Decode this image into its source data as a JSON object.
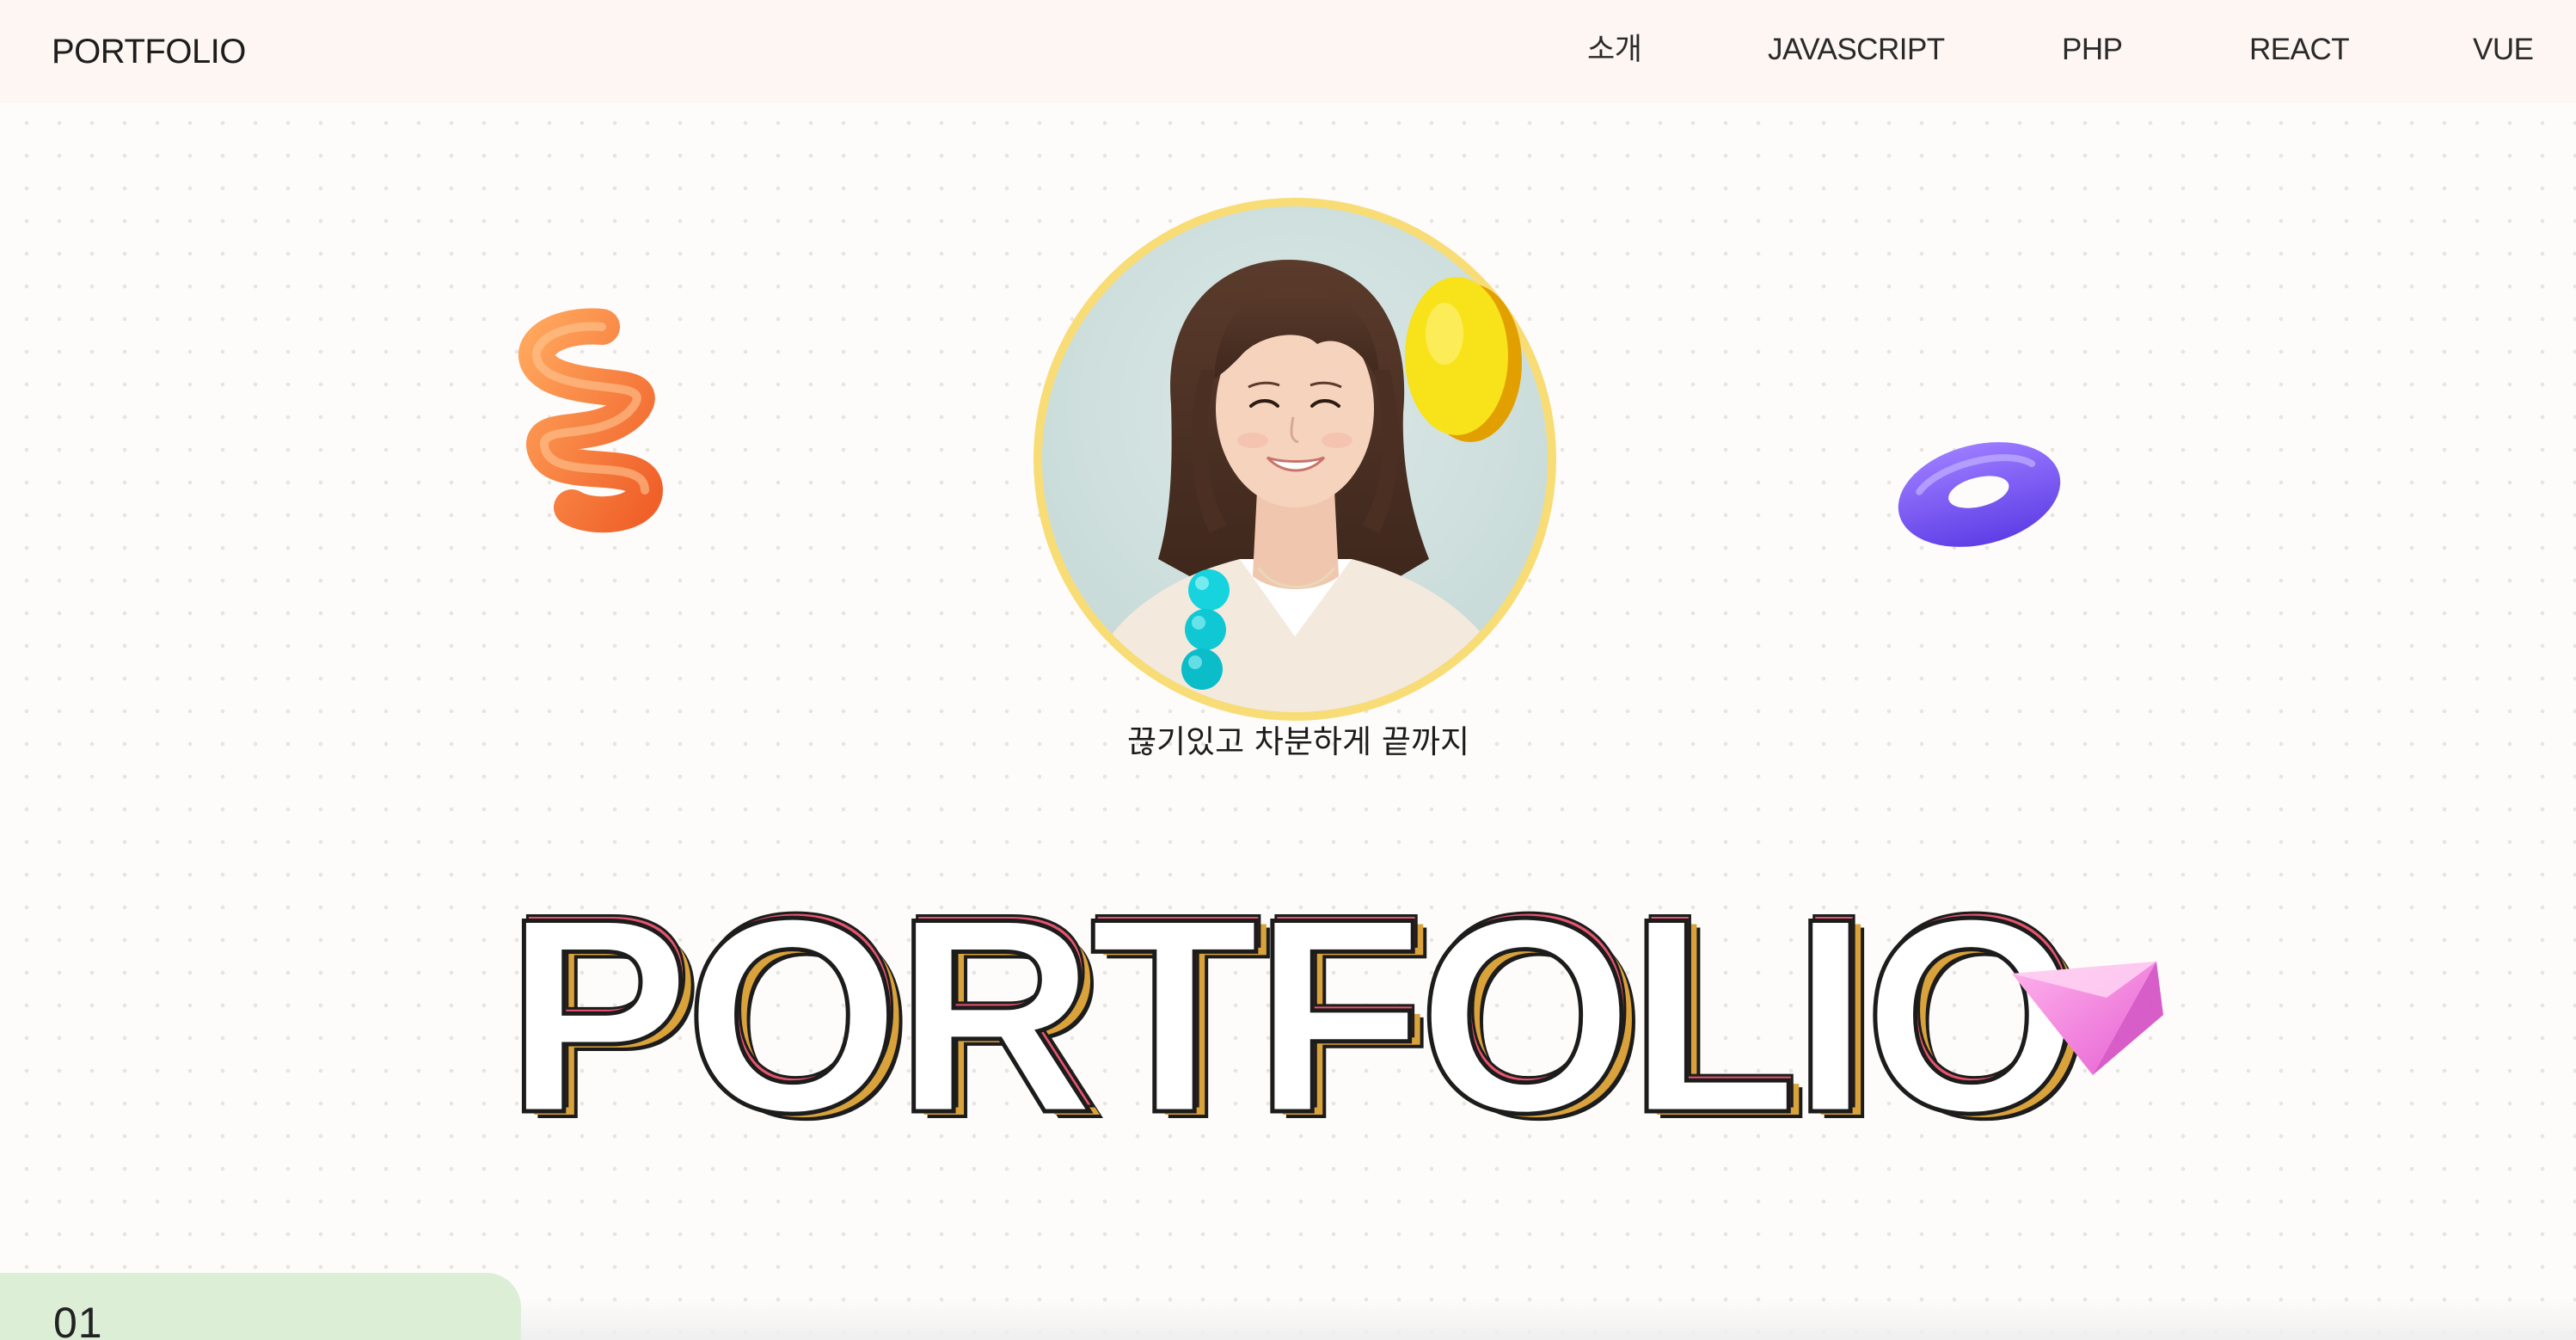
{
  "header": {
    "logo": "PORTFOLIO",
    "nav": [
      "소개",
      "JAVASCRIPT",
      "PHP",
      "REACT",
      "VUE"
    ]
  },
  "hero": {
    "tagline": "끊기있고 차분하게 끝까지",
    "title": "PORTFOLIO"
  },
  "section": {
    "number": "01"
  },
  "colors": {
    "header_bg": "#fdf6f2",
    "portrait_ring": "#f8dc75",
    "title_shadow_pink": "#e8546e",
    "title_shadow_gold": "#d9a23a",
    "section_tab": "#dcefd6"
  },
  "icons": [
    "orange-spring-shape",
    "yellow-coin-shape",
    "purple-torus-shape",
    "cyan-bead-stack-shape",
    "pink-pyramid-shape"
  ]
}
